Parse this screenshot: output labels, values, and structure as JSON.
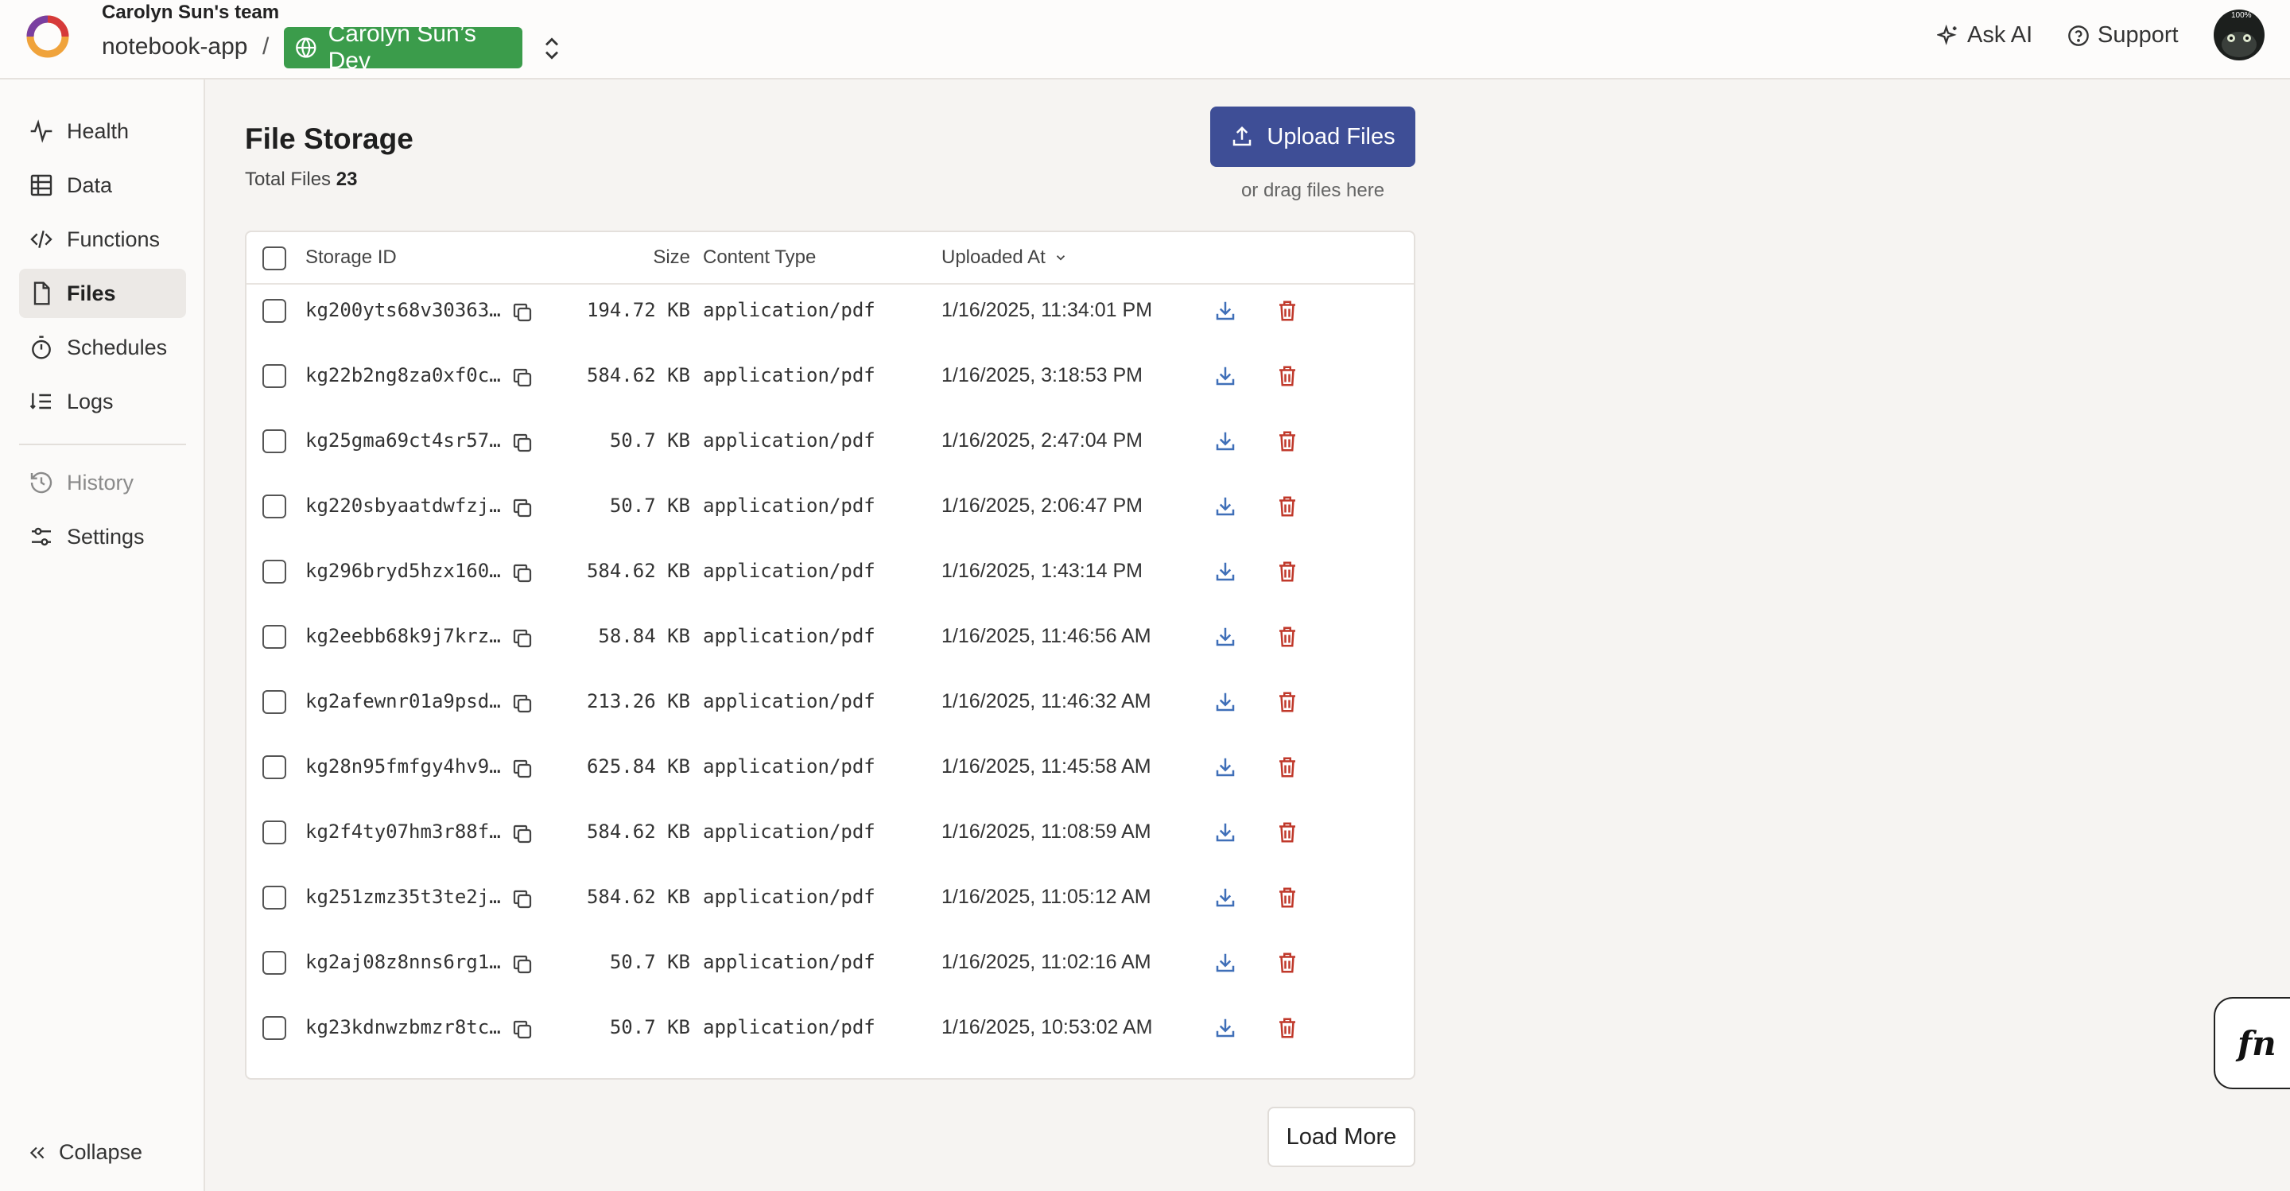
{
  "header": {
    "team_name": "Carolyn Sun's team",
    "project_name": "notebook-app",
    "separator": "/",
    "deployment_name": "Carolyn Sun’s Dev",
    "ask_ai_label": "Ask AI",
    "support_label": "Support",
    "avatar_badge": "100%"
  },
  "sidebar": {
    "items": [
      {
        "label": "Health",
        "icon": "activity-icon"
      },
      {
        "label": "Data",
        "icon": "table-icon"
      },
      {
        "label": "Functions",
        "icon": "code-icon"
      },
      {
        "label": "Files",
        "icon": "file-icon",
        "active": true
      },
      {
        "label": "Schedules",
        "icon": "stopwatch-icon"
      },
      {
        "label": "Logs",
        "icon": "list-ordered-icon"
      },
      {
        "label": "History",
        "icon": "history-icon",
        "muted": true
      },
      {
        "label": "Settings",
        "icon": "sliders-icon"
      }
    ],
    "collapse_label": "Collapse"
  },
  "main": {
    "title": "File Storage",
    "total_label": "Total Files",
    "total_count": "23",
    "upload_label": "Upload Files",
    "drag_hint": "or drag files here",
    "load_more_label": "Load More"
  },
  "table": {
    "headers": {
      "storage_id": "Storage ID",
      "size": "Size",
      "content_type": "Content Type",
      "uploaded_at": "Uploaded At"
    },
    "rows": [
      {
        "id": "kg200yts68v30363…",
        "size": "194.72 KB",
        "type": "application/pdf",
        "uploaded": "1/16/2025, 11:34:01 PM"
      },
      {
        "id": "kg22b2ng8za0xf0c…",
        "size": "584.62 KB",
        "type": "application/pdf",
        "uploaded": "1/16/2025, 3:18:53 PM"
      },
      {
        "id": "kg25gma69ct4sr57…",
        "size": "50.7 KB",
        "type": "application/pdf",
        "uploaded": "1/16/2025, 2:47:04 PM"
      },
      {
        "id": "kg220sbyaatdwfzj…",
        "size": "50.7 KB",
        "type": "application/pdf",
        "uploaded": "1/16/2025, 2:06:47 PM"
      },
      {
        "id": "kg296bryd5hzx160…",
        "size": "584.62 KB",
        "type": "application/pdf",
        "uploaded": "1/16/2025, 1:43:14 PM"
      },
      {
        "id": "kg2eebb68k9j7krz…",
        "size": "58.84 KB",
        "type": "application/pdf",
        "uploaded": "1/16/2025, 11:46:56 AM"
      },
      {
        "id": "kg2afewnr01a9psd…",
        "size": "213.26 KB",
        "type": "application/pdf",
        "uploaded": "1/16/2025, 11:46:32 AM"
      },
      {
        "id": "kg28n95fmfgy4hv9…",
        "size": "625.84 KB",
        "type": "application/pdf",
        "uploaded": "1/16/2025, 11:45:58 AM"
      },
      {
        "id": "kg2f4ty07hm3r88f…",
        "size": "584.62 KB",
        "type": "application/pdf",
        "uploaded": "1/16/2025, 11:08:59 AM"
      },
      {
        "id": "kg251zmz35t3te2j…",
        "size": "584.62 KB",
        "type": "application/pdf",
        "uploaded": "1/16/2025, 11:05:12 AM"
      },
      {
        "id": "kg2aj08z8nns6rg1…",
        "size": "50.7 KB",
        "type": "application/pdf",
        "uploaded": "1/16/2025, 11:02:16 AM"
      },
      {
        "id": "kg23kdnwzbmzr8tc…",
        "size": "50.7 KB",
        "type": "application/pdf",
        "uploaded": "1/16/2025, 10:53:02 AM"
      }
    ]
  },
  "function_runner": {
    "label": "fn"
  },
  "colors": {
    "deployment_badge": "#3b9c4b",
    "primary_button": "#3e4e96",
    "download_icon": "#3f6fb8",
    "delete_icon": "#c0392b"
  }
}
